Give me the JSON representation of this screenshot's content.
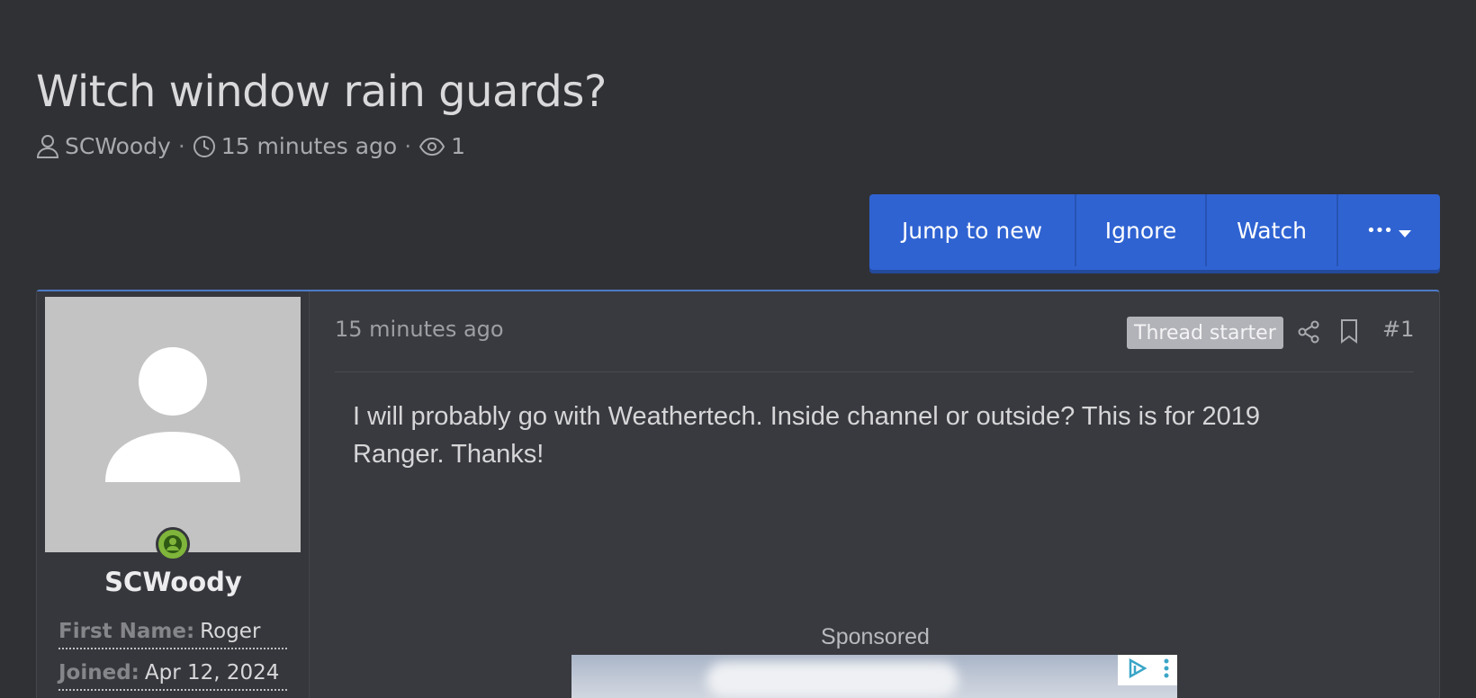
{
  "thread": {
    "title": "Witch window rain guards?",
    "author": "SCWoody",
    "posted": "15 minutes ago",
    "views": "1"
  },
  "actions": {
    "jump_to_new": "Jump to new",
    "ignore": "Ignore",
    "watch": "Watch",
    "more": "•••"
  },
  "post": {
    "time": "15 minutes ago",
    "badge": "Thread starter",
    "number": "#1",
    "body": "I will probably go with Weathertech. Inside channel or outside? This is for 2019 Ranger. Thanks!",
    "sponsored_label": "Sponsored"
  },
  "user": {
    "name": "SCWoody",
    "fields": [
      {
        "key": "First Name:",
        "value": "Roger"
      },
      {
        "key": "Joined:",
        "value": "Apr 12, 2024"
      }
    ]
  },
  "colors": {
    "background": "#303135",
    "accent_button": "#2f63d2",
    "online": "#7fb53a",
    "badge": "#b2b3b8"
  }
}
